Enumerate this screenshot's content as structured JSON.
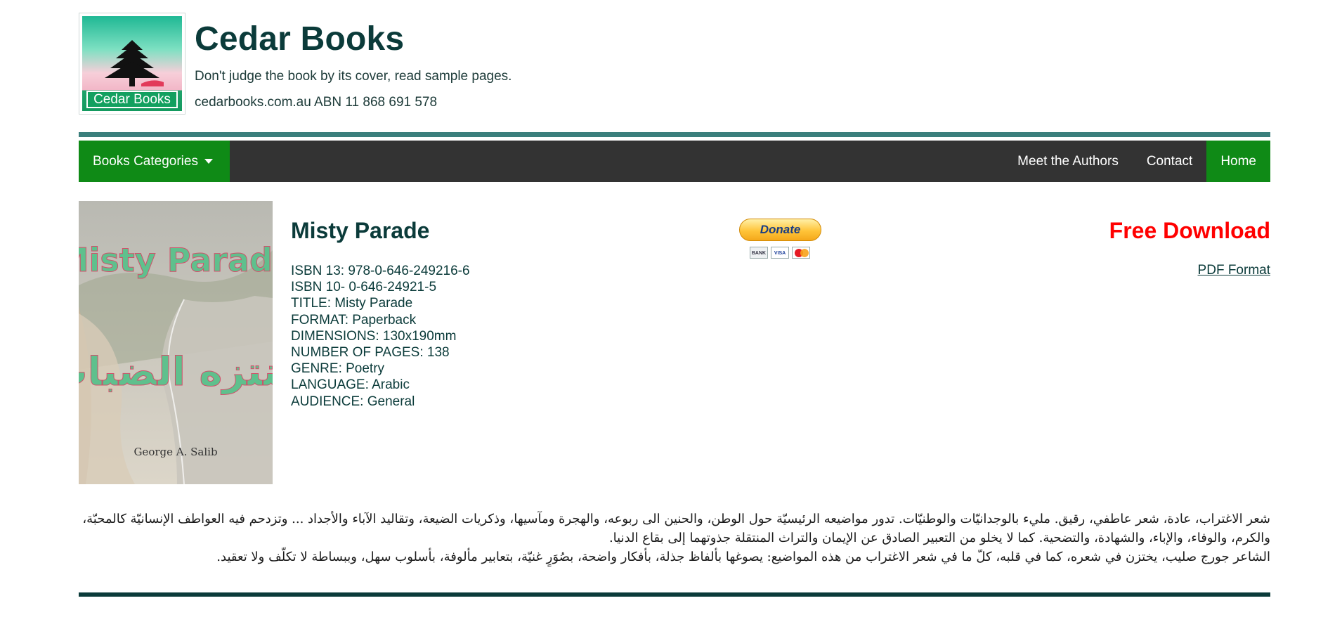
{
  "header": {
    "logo_text": "Cedar Books",
    "site_title": "Cedar Books",
    "tagline": "Don't judge the book by its cover, read sample pages.",
    "abn": "cedarbooks.com.au ABN 11 868 691 578"
  },
  "nav": {
    "categories_label": "Books Categories",
    "links": [
      "Meet the Authors",
      "Contact",
      "Home"
    ]
  },
  "cover": {
    "title_en": "Misty Parade",
    "title_ar": "منتزه الضباب",
    "author": "George A. Salib"
  },
  "book": {
    "title": "Misty Parade",
    "details": [
      "ISBN 13: 978-0-646-249216-6",
      "ISBN 10- 0-646-24921-5",
      "TITLE: Misty Parade",
      "FORMAT: Paperback",
      "DIMENSIONS: 130x190mm",
      "NUMBER OF PAGES: 138",
      "GENRE: Poetry",
      "LANGUAGE: Arabic",
      "AUDIENCE: General"
    ]
  },
  "donate": {
    "label": "Donate",
    "cards": [
      "BANK",
      "VISA",
      "mastercard"
    ]
  },
  "download": {
    "heading": "Free Download",
    "link": "PDF Format"
  },
  "description": {
    "lines": [
      "شعر الاغتراب، عادة، شعر عاطفي، رقيق. مليء بالوجدانيّات والوطنيّات. تدور مواضيعه الرئيسيّة حول الوطن، والحنين الى ربوعه، والهجرة ومآسيها، وذكريات الضيعة، وتقاليد الآباء والأجداد ... وتزدحم فيه العواطف الإنسانيّة كالمحبّة، والكرم، والوفاء، والإباء، والشهادة، والتضحية. كما لا يخلو من التعبير الصادق عن الإيمان والتراث المنتقلة جذوتهما إلى بقاع الدنيا.",
      "الشاعر جورج صليب، يختزن في شعره، كما في قلبه، كلّ ما في شعر الاغتراب من هذه المواضيع: يصوغها بألفاظ جذلة، بأفكار واضحة، بصُوَرٍ غنيّة، بتعابير مألوفة، بأسلوب سهل، وببساطة لا تكلّف ولا تعقيد."
    ]
  },
  "colors": {
    "brand_dark": "#0b3b3a",
    "nav_green": "#0f8a16",
    "nav_dark": "#333333",
    "free_download_red": "#ff0000",
    "rule_teal": "#3b7f7c"
  },
  "icons": [
    "cedar-tree-logo",
    "caret-down-icon",
    "paypal-donate-button",
    "card-icons"
  ]
}
